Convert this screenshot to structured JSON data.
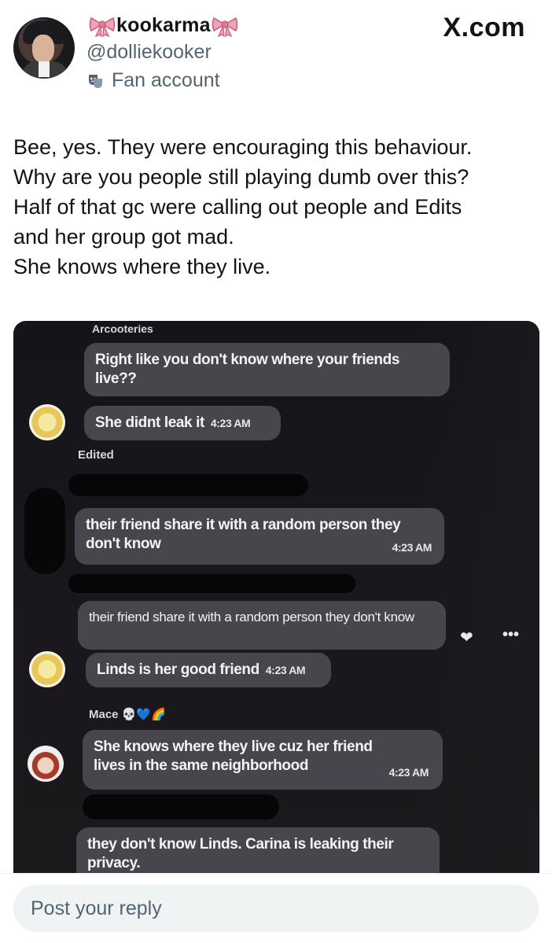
{
  "header": {
    "display_name": "kookarma",
    "handle": "@dolliekooker",
    "label": "Fan account",
    "brand": "X.com"
  },
  "post": {
    "lines": [
      "Bee, yes. They were encouraging this behaviour.",
      "Why are you people still playing dumb over this?",
      "Half of that gc were calling out people and Edits",
      "and her group got mad.",
      "She knows where they live."
    ]
  },
  "chat": {
    "sender_top": "Arcooteries",
    "messages": [
      {
        "text": "Right like you don't know where your friends live??"
      },
      {
        "text": "She didnt leak it",
        "time": "4:23 AM"
      },
      {
        "text": "their friend share it with a random person they don't know",
        "time": "4:23 AM"
      },
      {
        "text": "their friend share it with a random person they don't know"
      },
      {
        "text": "Linds is her good friend",
        "time": "4:23 AM"
      },
      {
        "text": "She knows where they live cuz her friend lives in the same neighborhood",
        "time": "4:23 AM"
      },
      {
        "text": "they don't know Linds. Carina is leaking their privacy."
      }
    ],
    "edited_label": "Edited",
    "sender_mace": "Mace",
    "sender_mace_emoji": "💀💙🌈"
  },
  "reply": {
    "placeholder": "Post your reply"
  },
  "icons": {
    "bow": "ribbon-bow-icon",
    "label": "theater-masks-icon",
    "react": "heart-react-icon",
    "more": "more-dots-icon"
  },
  "colors": {
    "text": "#0f1419",
    "muted": "#536471",
    "bubble": "#47464c",
    "chat_bg": "#19171b"
  }
}
